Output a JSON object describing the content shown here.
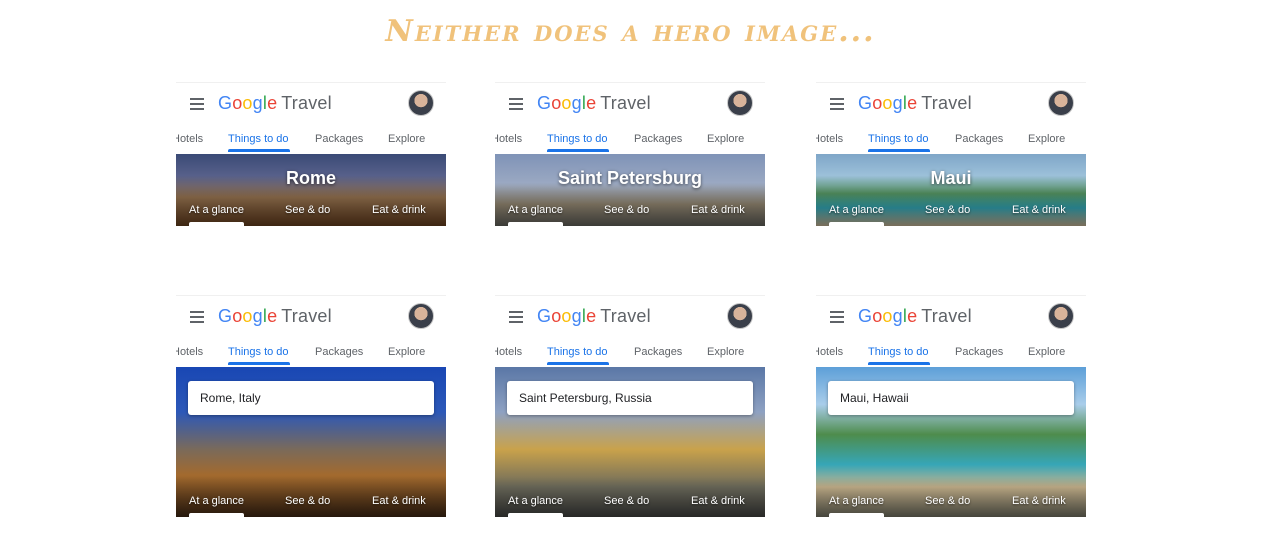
{
  "headline": "Neither does a hero image...",
  "brand": {
    "letters": [
      "G",
      "o",
      "o",
      "g",
      "l",
      "e"
    ],
    "product": "Travel",
    "colors": {
      "blue": "#4285f4",
      "red": "#ea4335",
      "yellow": "#fbbc05",
      "green": "#34a853",
      "accent": "#1a73e8"
    }
  },
  "tabs": [
    "Hotels",
    "Things to do",
    "Packages",
    "Explore"
  ],
  "subnav": [
    "At a glance",
    "See & do",
    "Eat & drink"
  ],
  "icons": {
    "menu": "hamburger-menu-icon",
    "avatar": "user-avatar"
  },
  "cards_top": [
    {
      "title": "Rome"
    },
    {
      "title": "Saint Petersburg"
    },
    {
      "title": "Maui"
    }
  ],
  "cards_bottom": [
    {
      "search_value": "Rome, Italy"
    },
    {
      "search_value": "Saint Petersburg, Russia"
    },
    {
      "search_value": "Maui, Hawaii"
    }
  ]
}
